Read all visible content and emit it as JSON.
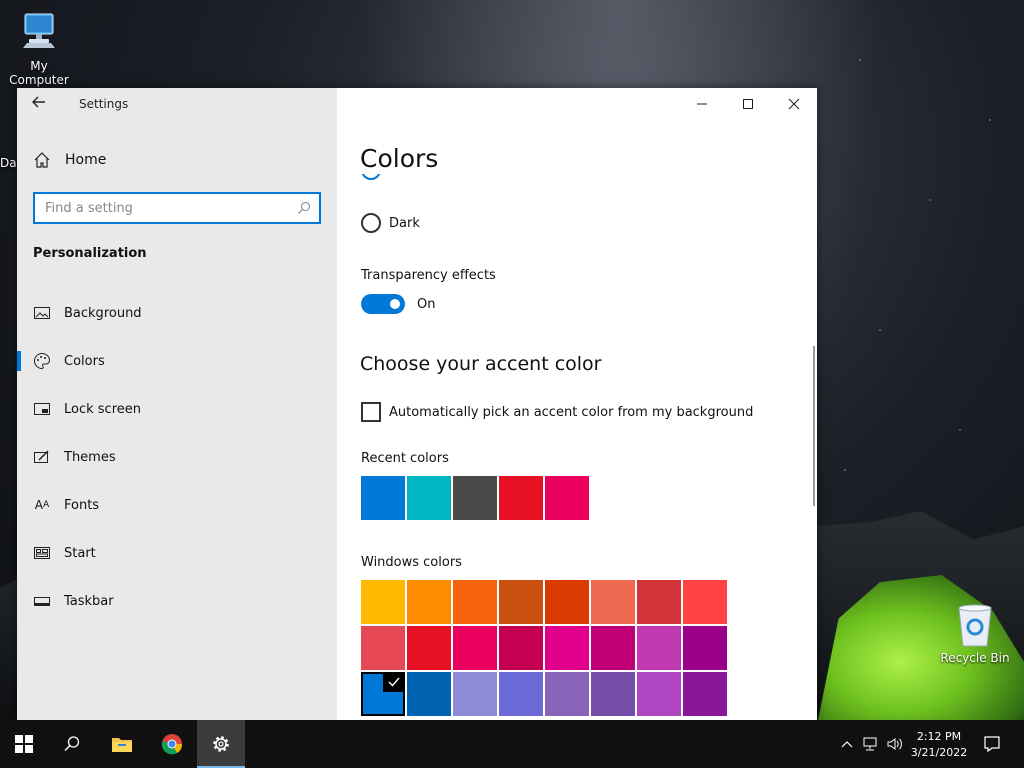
{
  "desktop": {
    "icons": [
      {
        "name": "my-computer",
        "label": "My Computer"
      },
      {
        "name": "recycle-bin",
        "label": "Recycle Bin"
      }
    ],
    "partial_label": "Da"
  },
  "window": {
    "title": "Settings",
    "home_label": "Home",
    "search_placeholder": "Find a setting",
    "section_title": "Personalization",
    "nav": [
      {
        "label": "Background",
        "icon": "picture-icon"
      },
      {
        "label": "Colors",
        "icon": "palette-icon",
        "active": true
      },
      {
        "label": "Lock screen",
        "icon": "lock-screen-icon"
      },
      {
        "label": "Themes",
        "icon": "themes-icon"
      },
      {
        "label": "Fonts",
        "icon": "fonts-icon"
      },
      {
        "label": "Start",
        "icon": "start-icon"
      },
      {
        "label": "Taskbar",
        "icon": "taskbar-icon"
      }
    ]
  },
  "content": {
    "title": "Colors",
    "dark_label": "Dark",
    "transparency_label": "Transparency effects",
    "transparency_state": "On",
    "accent_heading": "Choose your accent color",
    "auto_accent_label": "Automatically pick an accent color from my background",
    "recent_label": "Recent colors",
    "recent_colors": [
      "#0078d7",
      "#00b7c3",
      "#4c4a48",
      "#e81123",
      "#ea005e"
    ],
    "windows_label": "Windows colors",
    "windows_colors": [
      [
        "#ffb900",
        "#ff8c00",
        "#f7630c",
        "#ca5010",
        "#da3b01",
        "#ef6950",
        "#d13438",
        "#ff4343"
      ],
      [
        "#e74856",
        "#e81123",
        "#ea005e",
        "#c30052",
        "#e3008c",
        "#bf0077",
        "#c239b3",
        "#9a0089"
      ],
      [
        "#0078d7",
        "#0063b1",
        "#8e8cd8",
        "#6b69d6",
        "#8764b8",
        "#744da9",
        "#b146c2",
        "#881798"
      ]
    ],
    "selected_color": "#0078d7"
  },
  "taskbar": {
    "time": "2:12 PM",
    "date": "3/21/2022"
  },
  "colors": {
    "accent": "#0078d7",
    "sidebar_bg": "#e9e9e9",
    "taskbar_bg": "#101010"
  }
}
